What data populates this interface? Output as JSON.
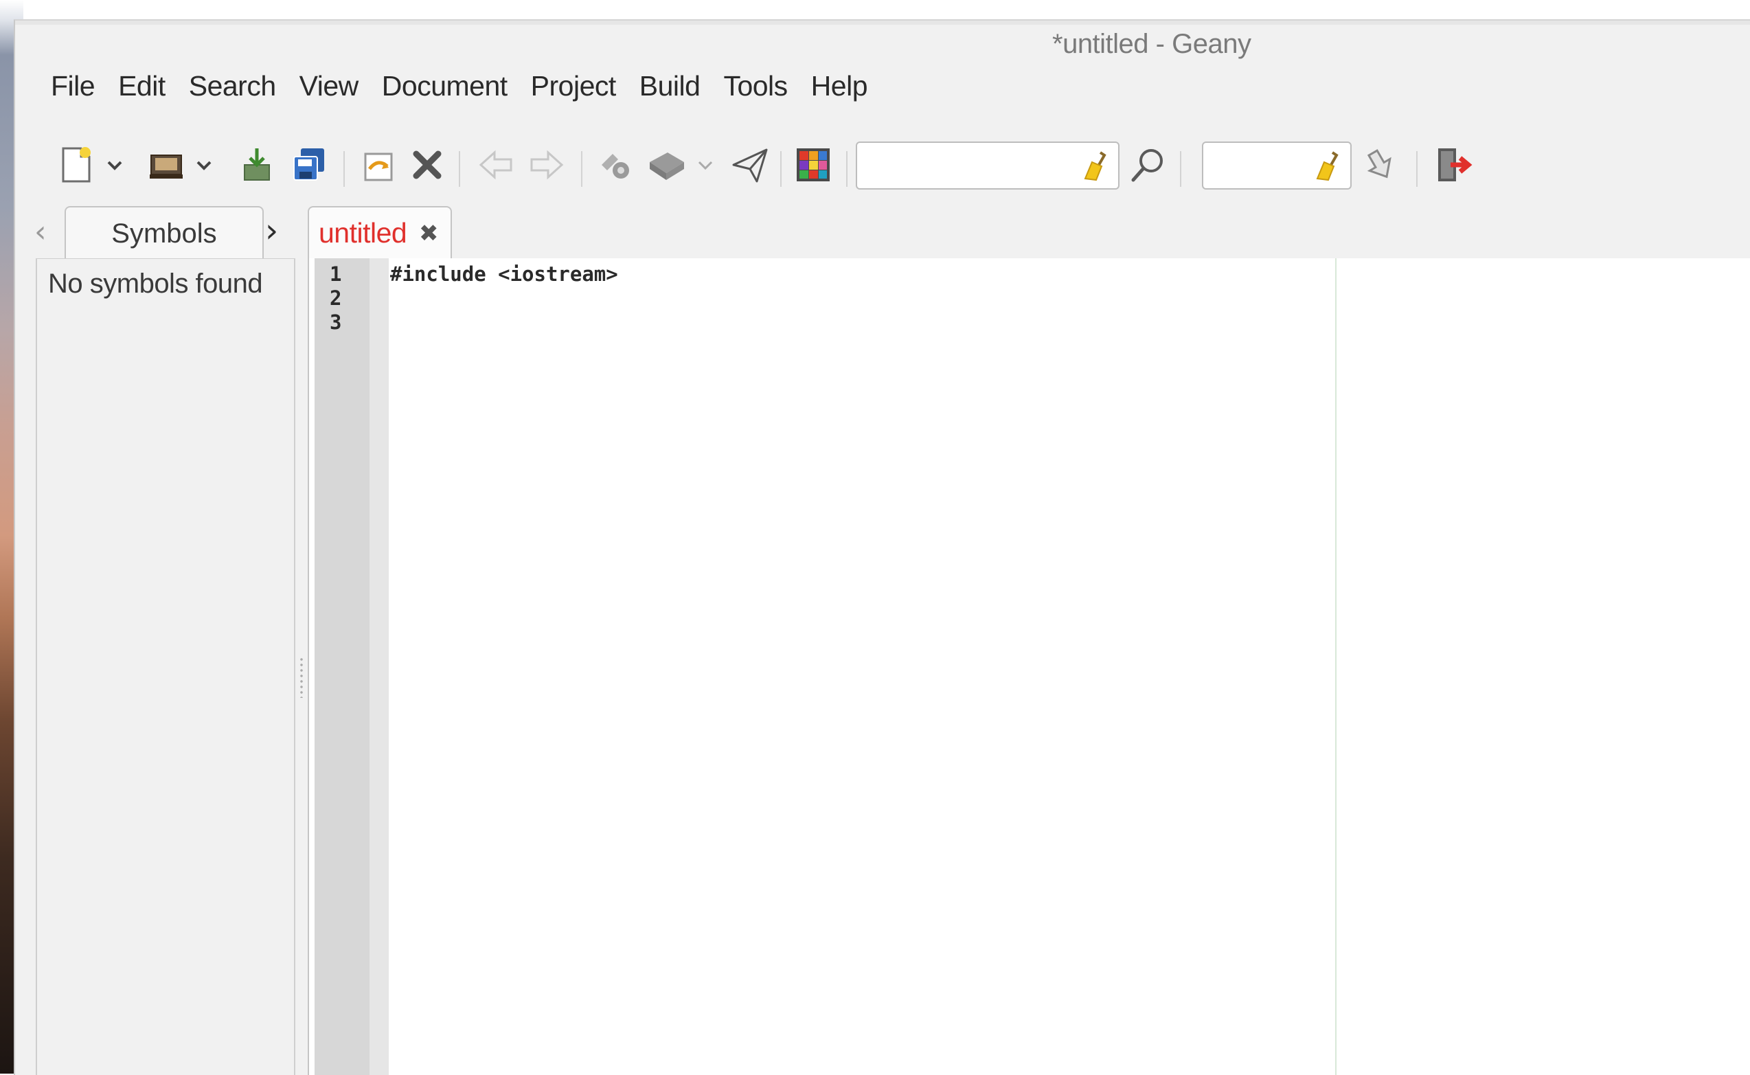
{
  "window": {
    "title": "*untitled - Geany"
  },
  "menubar": {
    "items": [
      "File",
      "Edit",
      "Search",
      "View",
      "Document",
      "Project",
      "Build",
      "Tools",
      "Help"
    ]
  },
  "toolbar": {
    "icons": [
      "new-file-icon",
      "open-file-icon",
      "save-icon",
      "save-all-icon",
      "revert-icon",
      "close-icon",
      "navigate-back-icon",
      "navigate-forward-icon",
      "compile-icon",
      "build-icon",
      "run-icon",
      "color-chooser-icon",
      "search-icon",
      "jump-to-line-icon",
      "quit-icon"
    ],
    "search_value": "",
    "goto_line_value": ""
  },
  "sidebar": {
    "tab_label": "Symbols",
    "message": "No symbols found"
  },
  "editor": {
    "tab_label": "untitled",
    "tab_close": "✖",
    "lines": [
      {
        "number": "1",
        "text": "#include <iostream>"
      },
      {
        "number": "2",
        "text": ""
      },
      {
        "number": "3",
        "text": ""
      }
    ]
  },
  "colors": {
    "modified_tab": "#e0302c",
    "gutter": "#d7d7d7",
    "chrome": "#f1f1f1"
  }
}
